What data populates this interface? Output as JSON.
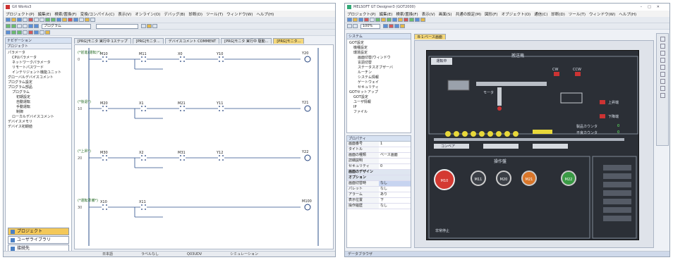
{
  "left_window": {
    "title": "GX Works3",
    "menu": [
      "プロジェクト(P)",
      "編集(E)",
      "検索/置換(F)",
      "変換/コンパイル(C)",
      "表示(V)",
      "オンライン(O)",
      "デバッグ(B)",
      "診断(D)",
      "ツール(T)",
      "ウィンドウ(W)",
      "ヘルプ(H)"
    ],
    "program_combo": "プログラム",
    "navigation_title": "ナビゲーション",
    "project_label": "プロジェクト",
    "tree": [
      "パラメータ",
      "CPUパラメータ",
      "ネットワークパラメータ",
      "リモートパスワード",
      "インテリジェント機能ユニット",
      "グローバルデバイスコメント",
      "プログラム設定",
      "プログラム部品",
      "プログラム",
      "初期設定",
      "自動運転",
      "手動運転",
      "制御",
      "ローカルデバイスコメント",
      "デバイスメモリ",
      "デバイス初期値"
    ],
    "tabs": [
      "[PRG]モニタ 実行中 1ステップ",
      "[PRG]モニタ...",
      "デバイスコメント COMMENT",
      "[PRG]モニタ 実行中 駆動...",
      "[PRG]モニタ..."
    ],
    "ladder_rungs": [
      {
        "comment": "(*前進(運転)*)",
        "step": "0",
        "contacts": [
          "M10",
          "M11",
          "X0",
          "Y10"
        ],
        "coil": "Y20"
      },
      {
        "comment": "(*後退*)",
        "step": "10",
        "contacts": [
          "M20",
          "X1",
          "M21",
          "Y11"
        ],
        "coil": "Y21"
      },
      {
        "comment": "(*上昇*)",
        "step": "20",
        "contacts": [
          "M30",
          "X2",
          "M31",
          "Y12"
        ],
        "coil": "Y22"
      },
      {
        "comment": "(*運転準備*)",
        "step": "30",
        "contacts": [
          "X10",
          "X11"
        ],
        "coil": "M100"
      }
    ],
    "nav_buttons": [
      "プロジェクト",
      "ユーザライブラリ",
      "接続先"
    ],
    "status": [
      "日本語",
      "ラベルなし",
      "Q03UDV",
      "シミュレーション"
    ]
  },
  "right_window": {
    "title": "MELSOFT GT Designer3 (GOT2000)",
    "menu": [
      "プロジェクト(P)",
      "編集(E)",
      "検索/置換(F)",
      "表示(V)",
      "画面(S)",
      "共通の設定(M)",
      "図形(F)",
      "オブジェクト(O)",
      "通信(C)",
      "診断(D)",
      "ツール(T)",
      "ウィンドウ(W)",
      "ヘルプ(H)"
    ],
    "zoom": "100%",
    "system_tree": [
      "GOT設定",
      "機種設定",
      "環境設定",
      "画面切替/ウィンドウ",
      "言語切替",
      "ステータスオブザーバ",
      "ルーチン",
      "システム情報",
      "ゲートウェイ",
      "セキュリティ",
      "GOTセットアップ",
      "GOT設定",
      "ユーザ情報",
      "IP",
      "ファイル"
    ],
    "screen_tab": "B-1:ベース画面",
    "properties_title": "プロパティ",
    "props": [
      {
        "k": "画面番号",
        "v": "1"
      },
      {
        "k": "タイトル",
        "v": ""
      },
      {
        "k": "画面の種類",
        "v": "ベース画面"
      },
      {
        "k": "詳細説明",
        "v": ""
      },
      {
        "k": "セキュリティ",
        "v": "0"
      },
      {
        "k": "画面のデザイン",
        "v": ""
      },
      {
        "k": "オプション",
        "v": ""
      },
      {
        "k": "画面切替時",
        "v": "なし"
      },
      {
        "k": "パレット",
        "v": "なし"
      },
      {
        "k": "アラーム",
        "v": "あり"
      },
      {
        "k": "表示位置",
        "v": "下"
      },
      {
        "k": "操作履歴",
        "v": "なし"
      }
    ],
    "screen_labels": {
      "title": "搬送機",
      "status": "運転中",
      "drive_motor": "モータ",
      "cw": "CW",
      "ccw": "CCW",
      "up": "上昇端",
      "down": "下降端",
      "counter1": "製品カウンタ",
      "counter2": "不良カウンタ",
      "c1v": "0",
      "c2v": "0",
      "conveyor": "コンベア",
      "panel_title": "操作盤",
      "emergency": "非常停止"
    },
    "lamps": [
      "M10",
      "M11",
      "M20",
      "M21",
      "M22"
    ],
    "data_view": "データブラウザ"
  }
}
